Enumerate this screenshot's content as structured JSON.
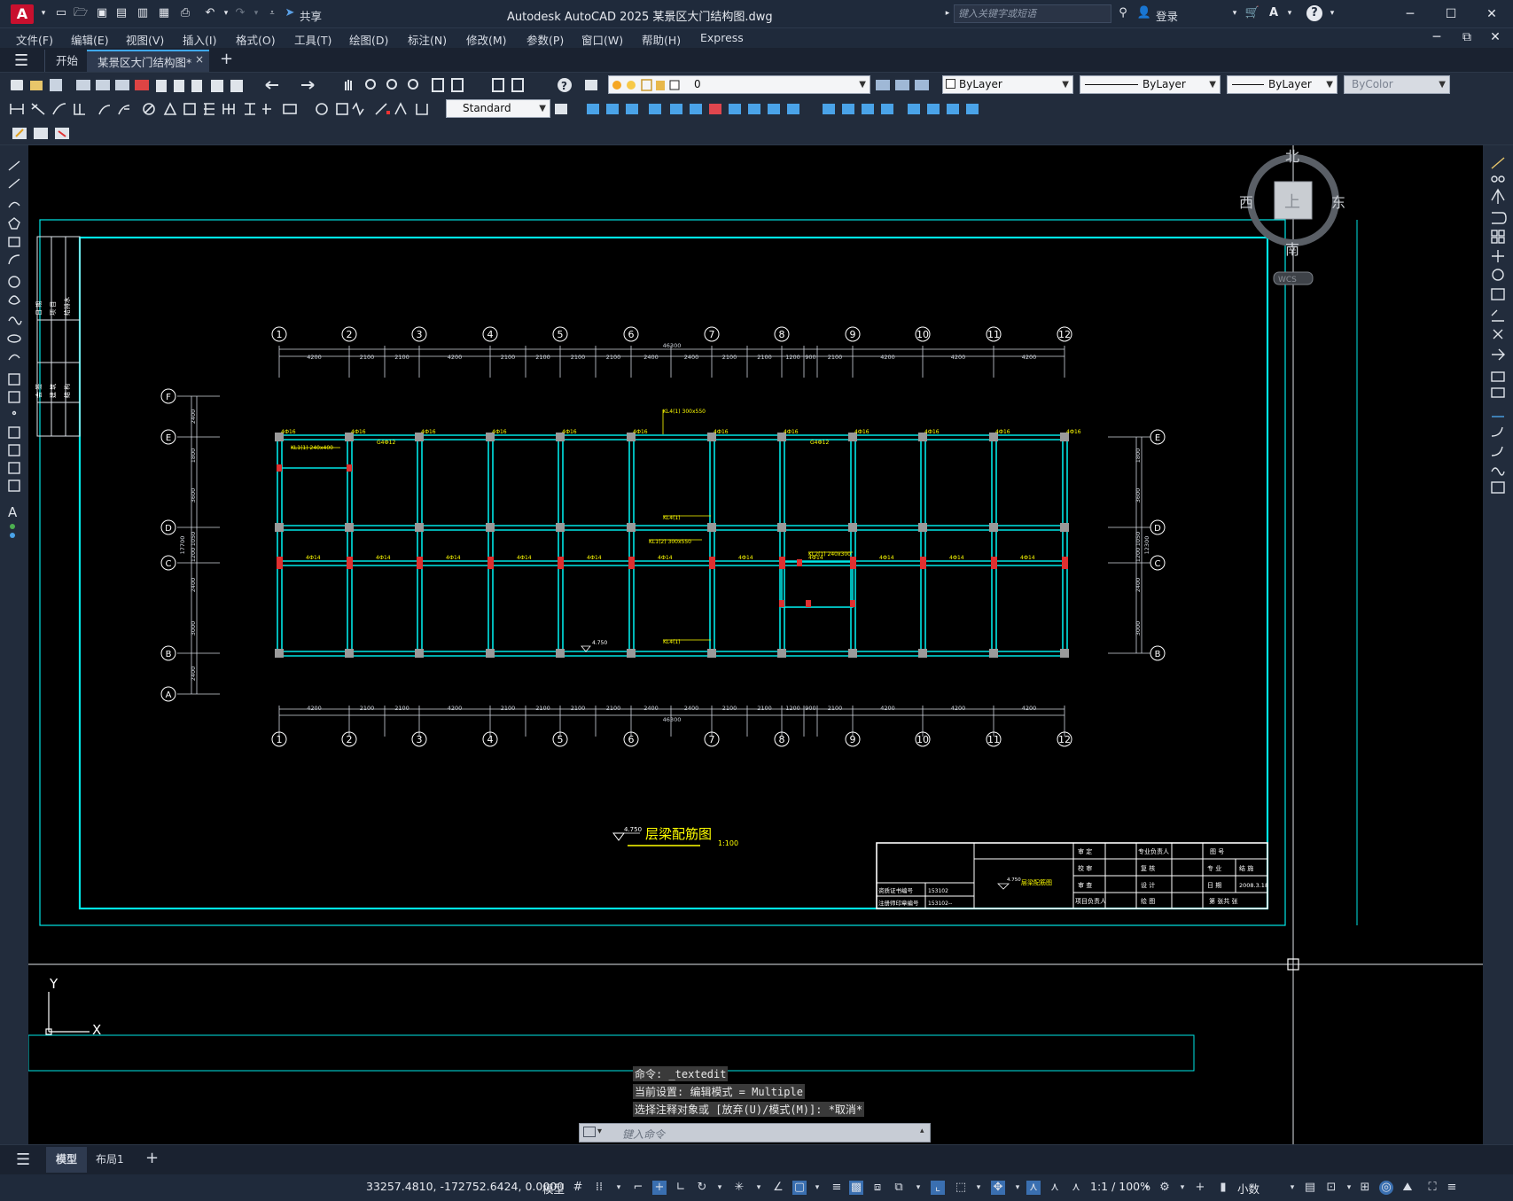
{
  "app": {
    "icon_letter": "A",
    "title": "Autodesk AutoCAD 2025    某景区大门结构图.dwg",
    "share_label": "共享",
    "search_placeholder": "键入关键字或短语",
    "login_label": "登录"
  },
  "menu": [
    "文件(F)",
    "编辑(E)",
    "视图(V)",
    "插入(I)",
    "格式(O)",
    "工具(T)",
    "绘图(D)",
    "标注(N)",
    "修改(M)",
    "参数(P)",
    "窗口(W)",
    "帮助(H)",
    "Express"
  ],
  "tabs": {
    "start": "开始",
    "active": "某景区大门结构图*",
    "close": "×",
    "add": "+"
  },
  "toolbar": {
    "layer_value": "0",
    "color_value": "ByLayer",
    "linetype_value": "ByLayer",
    "lineweight_value": "ByLayer",
    "plotstyle_value": "ByColor",
    "textstyle_value": "Standard"
  },
  "viewcube": {
    "north": "北",
    "south": "南",
    "east": "东",
    "west": "西",
    "face": "上",
    "wcs": "WCS"
  },
  "drawing": {
    "axis_numbers": [
      "1",
      "2",
      "3",
      "4",
      "5",
      "6",
      "7",
      "8",
      "9",
      "10",
      "11",
      "12"
    ],
    "axis_letters_left": [
      "F",
      "E",
      "D",
      "C",
      "B",
      "A"
    ],
    "axis_letters_right": [
      "E",
      "D",
      "C",
      "B"
    ],
    "top_dims": [
      "4200",
      "2100",
      "2100",
      "4200",
      "2100",
      "2100",
      "2100",
      "2100",
      "2400",
      "2400",
      "2100",
      "2100",
      "1200",
      "900",
      "2100",
      "4200",
      "4200",
      "4200"
    ],
    "total_dim": "46300",
    "left_dims": [
      "2400",
      "1800",
      "3600",
      "1050",
      "1200",
      "2400",
      "3000",
      "2400"
    ],
    "left_total": "17700",
    "right_dims": [
      "1800",
      "3600",
      "1050",
      "1200",
      "2400",
      "3000"
    ],
    "right_total": "12300",
    "elev_label": "4.750",
    "plan_title": "层梁配筋图",
    "plan_scale": "1:100",
    "beam_labels": [
      "4Ф16",
      "4Ф16",
      "4Ф16",
      "4Ф16",
      "4Ф16",
      "4Ф16",
      "4Ф16",
      "4Ф16",
      "4Ф16",
      "4Ф16",
      "4Ф16",
      "4Ф16"
    ],
    "mid_labels": [
      "4Ф14",
      "4Ф14",
      "4Ф14",
      "4Ф14",
      "4Ф14",
      "4Ф14",
      "4Ф14",
      "4Ф14",
      "4Ф14",
      "4Ф14",
      "4Ф14"
    ],
    "g_labels": [
      "G4Ф12",
      "G4Ф12"
    ],
    "kl_labels": [
      "KL4(1) 300x550",
      "KL1(1) 240x400",
      "KL1(2) 300x550",
      "KL2(1) 240x300",
      "KL4(1)",
      "KL4(1)"
    ],
    "title_block": {
      "r1": [
        "审  定",
        "专业负责人",
        "图  号"
      ],
      "r2": [
        "校  审",
        "复  核",
        "专  业",
        "结  施"
      ],
      "r3": [
        "审  查",
        "设  计",
        "日  期",
        "2008.3.18"
      ],
      "r4": [
        "项目负责人",
        "绘  图",
        "第    张共    张"
      ],
      "cert1": "资质证书编号",
      "cert1_val": "153102",
      "cert2": "注册师印章编号",
      "cert2_val": "153102--"
    },
    "side_table": [
      "日  期",
      "项  目",
      "会  签",
      "建  筑",
      "结  构",
      "给排水"
    ]
  },
  "ucs": {
    "x": "X",
    "y": "Y"
  },
  "command": {
    "lines": [
      "命令: _textedit",
      "当前设置: 编辑模式 = Multiple",
      "选择注释对象或 [放弃(U)/模式(M)]: *取消*"
    ],
    "placeholder": "键入命令"
  },
  "layout_tabs": [
    "模型",
    "布局1"
  ],
  "status": {
    "coords": "33257.4810, -172752.6424, 0.0000",
    "mode": "模型",
    "scale": "1:1 / 100%",
    "units": "小数"
  }
}
